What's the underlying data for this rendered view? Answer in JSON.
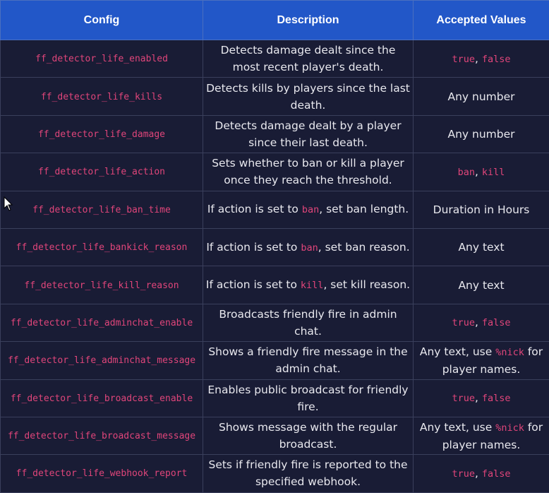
{
  "headers": {
    "config": "Config",
    "description": "Description",
    "accepted": "Accepted Values"
  },
  "rows": [
    {
      "config": "ff_detector_life_enabled",
      "desc_text": "Detects damage dealt since the most recent player's death.",
      "acc_code1": "true",
      "acc_sep": ",",
      "acc_code2": "false"
    },
    {
      "config": "ff_detector_life_kills",
      "desc_text": "Detects kills by players since the last death.",
      "acc_text": "Any number"
    },
    {
      "config": "ff_detector_life_damage",
      "desc_text": "Detects damage dealt by a player since their last death.",
      "acc_text": "Any number"
    },
    {
      "config": "ff_detector_life_action",
      "desc_text": "Sets whether to ban or kill a player once they reach the threshold.",
      "acc_code1": "ban",
      "acc_sep": ",",
      "acc_code2": "kill"
    },
    {
      "config": "ff_detector_life_ban_time",
      "desc_pre": "If action is set to",
      "desc_code": "ban",
      "desc_post": ", set ban length.",
      "acc_text": "Duration in Hours"
    },
    {
      "config": "ff_detector_life_bankick_reason",
      "desc_pre": "If action is set to",
      "desc_code": "ban",
      "desc_post": ", set ban reason.",
      "acc_text": "Any text"
    },
    {
      "config": "ff_detector_life_kill_reason",
      "desc_pre": "If action is set to",
      "desc_code": "kill",
      "desc_post": ", set kill reason.",
      "acc_text": "Any text"
    },
    {
      "config": "ff_detector_life_adminchat_enable",
      "desc_text": "Broadcasts friendly fire in admin chat.",
      "acc_code1": "true",
      "acc_sep": ",",
      "acc_code2": "false"
    },
    {
      "config": "ff_detector_life_adminchat_message",
      "desc_text": "Shows a friendly fire message in the admin chat.",
      "acc_pre": "Any text, use",
      "acc_code": "%nick",
      "acc_post": "for player names."
    },
    {
      "config": "ff_detector_life_broadcast_enable",
      "desc_text": "Enables public broadcast for friendly fire.",
      "acc_code1": "true",
      "acc_sep": ",",
      "acc_code2": "false"
    },
    {
      "config": "ff_detector_life_broadcast_message",
      "desc_text": "Shows message with the regular broadcast.",
      "acc_pre": "Any text, use",
      "acc_code": "%nick",
      "acc_post": "for player names."
    },
    {
      "config": "ff_detector_life_webhook_report",
      "desc_text": "Sets if friendly fire is reported to the specified webhook.",
      "acc_code1": "true",
      "acc_sep": ",",
      "acc_code2": "false"
    }
  ]
}
